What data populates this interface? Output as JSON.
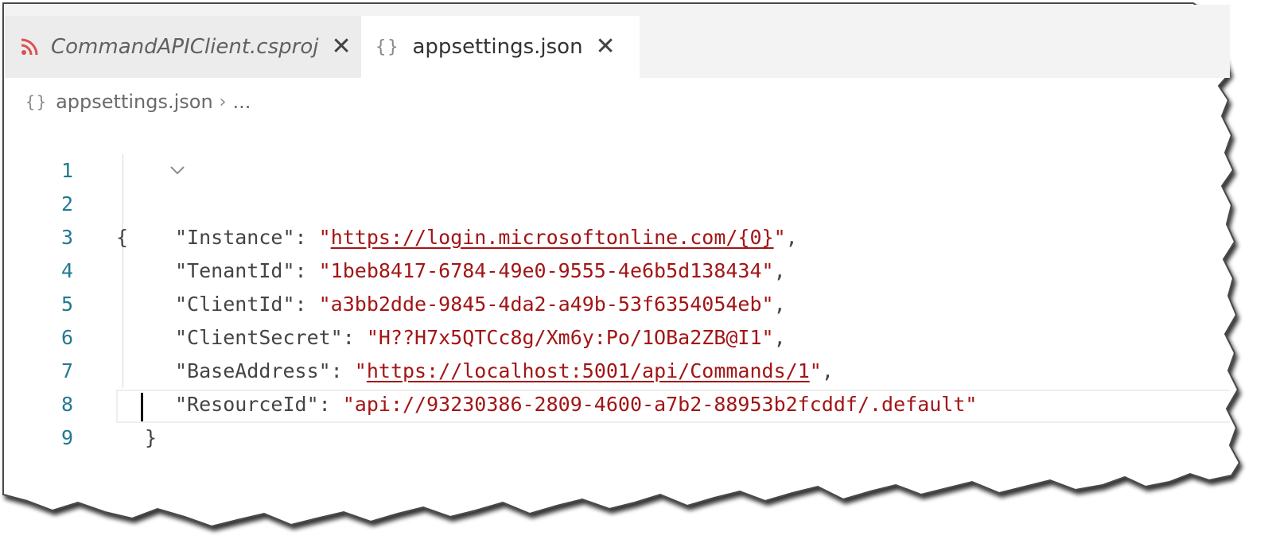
{
  "tabs": [
    {
      "label": "CommandAPIClient.csproj",
      "icon": "rss-icon",
      "close": "✕",
      "active": false
    },
    {
      "label": "appsettings.json",
      "icon": "braces-icon",
      "close": "✕",
      "active": true
    }
  ],
  "icons": {
    "braces_glyph": "{}"
  },
  "breadcrumb": {
    "file": "appsettings.json",
    "separator": "›",
    "rest": "..."
  },
  "editor": {
    "line_numbers": [
      "1",
      "2",
      "3",
      "4",
      "5",
      "6",
      "7",
      "8",
      "9"
    ],
    "lines": [
      {
        "open": "{"
      },
      {
        "key": "\"Instance\"",
        "sep": ": ",
        "q1": "\"",
        "value": "https://login.microsoftonline.com/{0}",
        "q2": "\"",
        "end": ","
      },
      {
        "key": "\"TenantId\"",
        "sep": ": ",
        "value": "\"1beb8417-6784-49e0-9555-4e6b5d138434\"",
        "end": ","
      },
      {
        "key": "\"ClientId\"",
        "sep": ": ",
        "value": "\"a3bb2dde-9845-4da2-a49b-53f6354054eb\"",
        "end": ","
      },
      {
        "key": "\"ClientSecret\"",
        "sep": ": ",
        "value": "\"H??H7x5QTCc8g/Xm6y:Po/1OBa2ZB@I1\"",
        "end": ","
      },
      {
        "key": "\"BaseAddress\"",
        "sep": ": ",
        "q1": "\"",
        "value": "https://localhost:5001/api/Commands/1",
        "q2": "\"",
        "end": ","
      },
      {
        "key": "\"ResourceId\"",
        "sep": ": ",
        "value": "\"api://93230386-2809-4600-a7b2-88953b2fcddf/.default\""
      },
      {
        "close": "}"
      }
    ]
  },
  "colors": {
    "string": "#a31515",
    "line_number": "#237893",
    "key": "#444444"
  }
}
